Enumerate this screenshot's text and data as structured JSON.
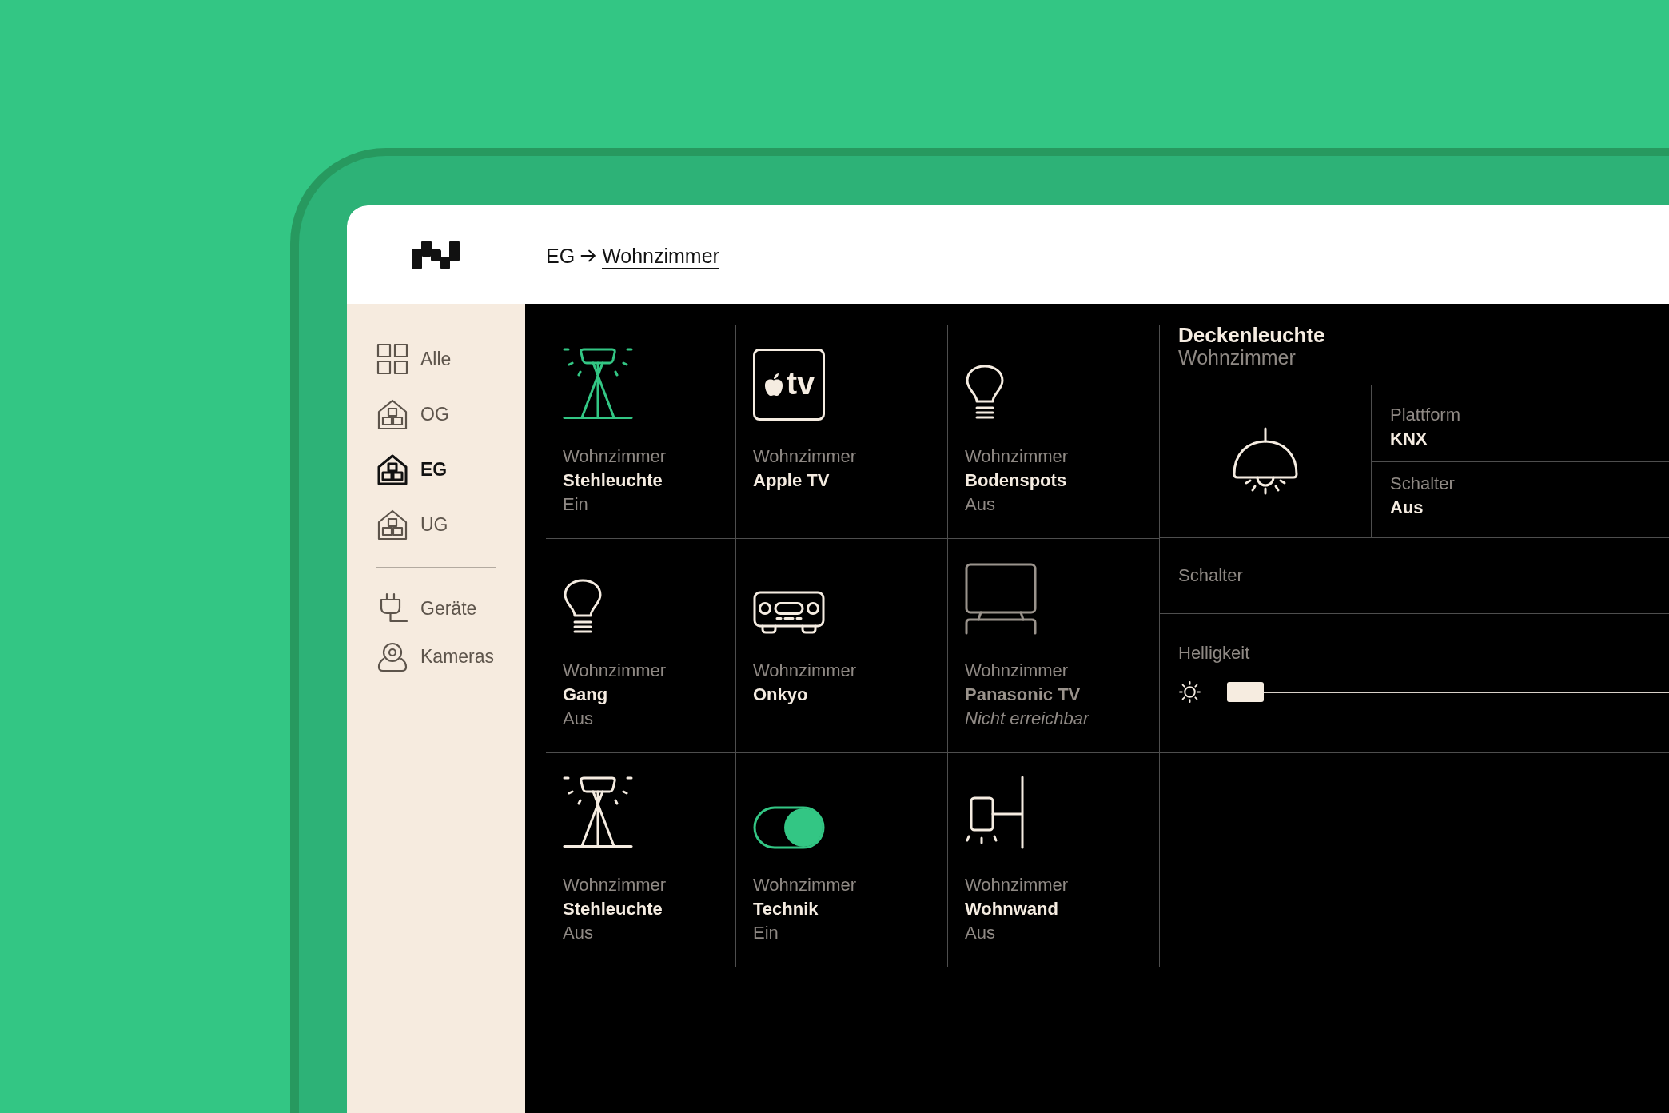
{
  "header": {
    "breadcrumb": [
      {
        "label": "EG",
        "current": false
      },
      {
        "label": "Wohnzimmer",
        "current": true
      }
    ]
  },
  "sidebar": {
    "floors": [
      {
        "kind": "all",
        "label": "Alle",
        "selected": false
      },
      {
        "kind": "floor",
        "label": "OG",
        "selected": false
      },
      {
        "kind": "floor",
        "label": "EG",
        "selected": true
      },
      {
        "kind": "floor",
        "label": "UG",
        "selected": false
      }
    ],
    "sections": [
      {
        "kind": "devices",
        "label": "Geräte",
        "selected": false
      },
      {
        "kind": "cameras",
        "label": "Kameras",
        "selected": false
      }
    ]
  },
  "device_rows": [
    {
      "devices": [
        {
          "kind": "floor-lamp",
          "room": "Wohnzimmer",
          "name": "Stehleuchte",
          "status": "Ein",
          "on": true,
          "reachable": true
        },
        {
          "kind": "streaming-box",
          "room": "Wohnzimmer",
          "name": "Apple TV",
          "logo_text": "tv",
          "reachable": true
        },
        {
          "kind": "bulb",
          "room": "Wohnzimmer",
          "name": "Bodenspots",
          "status": "Aus",
          "on": false,
          "reachable": true
        }
      ]
    },
    {
      "devices": [
        {
          "kind": "bulb",
          "room": "Wohnzimmer",
          "name": "Gang",
          "status": "Aus",
          "on": false,
          "reachable": true
        },
        {
          "kind": "receiver",
          "room": "Wohnzimmer",
          "name": "Onkyo",
          "reachable": true
        },
        {
          "kind": "television",
          "room": "Wohnzimmer",
          "name": "Panasonic TV",
          "status": "Nicht erreichbar",
          "reachable": false
        }
      ]
    },
    {
      "devices": [
        {
          "kind": "floor-lamp",
          "room": "Wohnzimmer",
          "name": "Stehleuchte",
          "status": "Aus",
          "on": false,
          "reachable": true
        },
        {
          "kind": "switch",
          "room": "Wohnzimmer",
          "name": "Technik",
          "status": "Ein",
          "on": true,
          "reachable": true
        },
        {
          "kind": "wall-light",
          "room": "Wohnzimmer",
          "name": "Wohnwand",
          "status": "Aus",
          "on": false,
          "reachable": true
        }
      ]
    }
  ],
  "detail": {
    "kind": "ceiling-lamp",
    "title": "Deckenleuchte",
    "room": "Wohnzimmer",
    "properties": [
      {
        "label": "Plattform",
        "value": "KNX"
      },
      {
        "label": "Schalter",
        "value": "Aus"
      }
    ],
    "switch": {
      "label": "Schalter"
    },
    "brightness": {
      "label": "Helligkeit",
      "level": 0
    }
  }
}
